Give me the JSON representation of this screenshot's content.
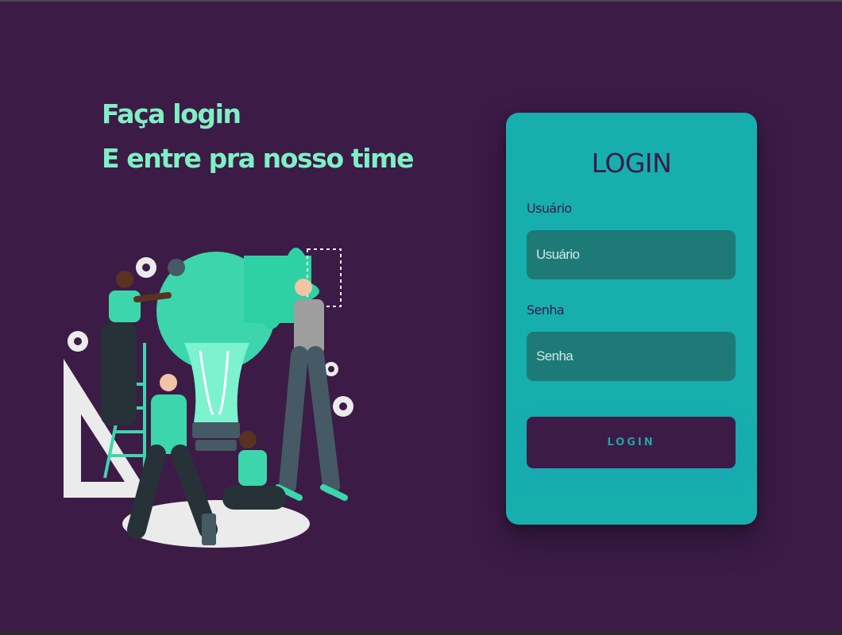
{
  "hero": {
    "line1": "Faça login",
    "line2": "E entre pra nosso time"
  },
  "illustration": {
    "icon": "team-puzzle-lightbulb-illustration",
    "accent": "#3dd6ac",
    "dark": "#263238",
    "light": "#ebebeb"
  },
  "login": {
    "title": "LOGIN",
    "username_label": "Usuário",
    "username_placeholder": "Usuário",
    "username_value": "",
    "password_label": "Senha",
    "password_placeholder": "Senha",
    "password_value": "",
    "button_label": "LOGIN"
  },
  "colors": {
    "background": "#3c1b47",
    "headline": "#7ef0c4",
    "card": "#17aeae",
    "input": "#1e7a77",
    "button": "#3c1b47",
    "button_text": "#1fa4a4"
  }
}
